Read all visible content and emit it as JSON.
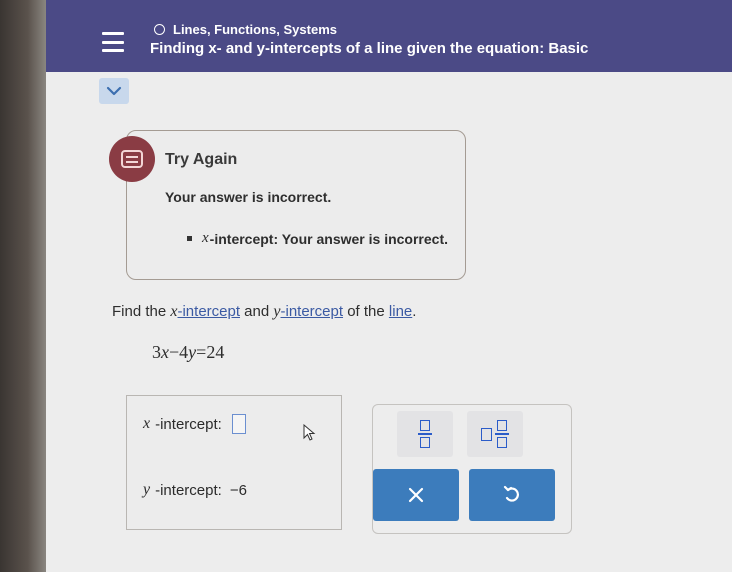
{
  "header": {
    "topic": "Lines, Functions, Systems",
    "title": "Finding x- and y-intercepts of a line given the equation: Basic"
  },
  "feedback": {
    "title": "Try Again",
    "message": "Your answer is incorrect.",
    "bullet_var": "x",
    "bullet_text": "-intercept: Your answer is incorrect."
  },
  "problem": {
    "t1": "Find the ",
    "var1": "x",
    "link1": "-intercept",
    "t2": " and ",
    "var2": "y",
    "link2": "-intercept",
    "t3": " of the ",
    "link3": "line",
    "t4": ".",
    "equation": {
      "c1": "3",
      "v1": "x",
      "op1": "−",
      "c2": "4",
      "v2": "y",
      "op2": "=",
      "rhs": "24"
    }
  },
  "answers": {
    "x_var": "x",
    "x_label": "-intercept:",
    "x_value": "",
    "y_var": "y",
    "y_label": "-intercept:",
    "y_value": "−6"
  },
  "colors": {
    "header_bg": "#4b4a86",
    "accent_blue": "#3c7cbc",
    "feedback_icon": "#8a3c44",
    "link": "#3b5aa3"
  },
  "icons": {
    "menu": "menu-icon",
    "topic": "circle-icon",
    "expand": "chevron-down-icon",
    "feedback": "message-icon",
    "fraction": "fraction-icon",
    "mixed_number": "mixed-number-icon",
    "clear": "x-icon",
    "undo": "undo-icon"
  }
}
